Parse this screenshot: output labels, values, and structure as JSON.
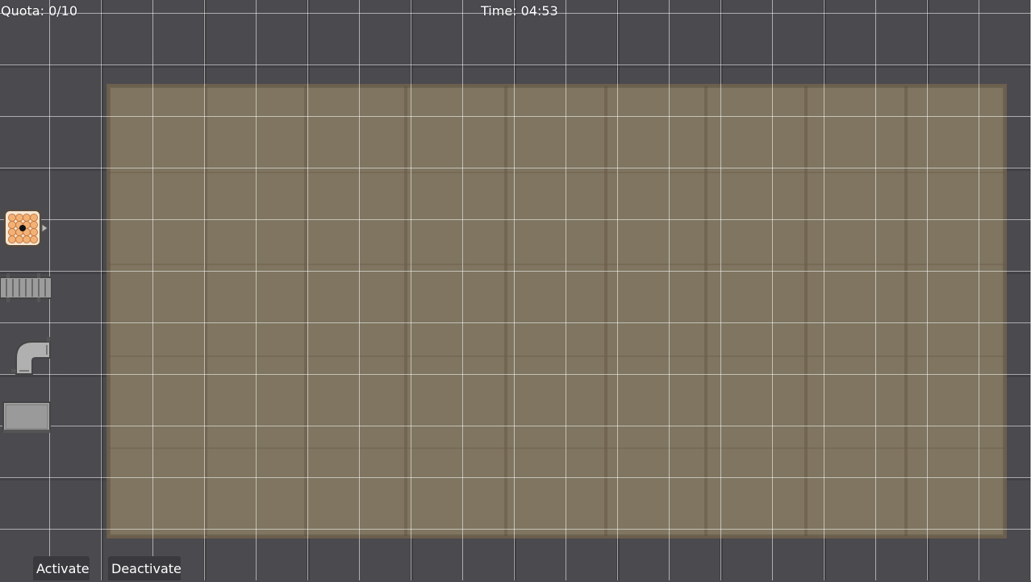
{
  "hud": {
    "quota": "Quota: 0/10",
    "time": "Time: 04:53"
  },
  "palette": {
    "items": [
      {
        "icon": "crate-icon"
      },
      {
        "icon": "conveyor-belt-icon"
      },
      {
        "icon": "pipe-elbow-icon"
      },
      {
        "icon": "metal-box-icon"
      }
    ]
  },
  "controls": {
    "activate_label": "Activate",
    "deactivate_label": "Deactivate"
  },
  "colors": {
    "background": "#4a4a4f",
    "play_area": "#7f7560",
    "play_area_border": "#6b5e4c",
    "grid_lines": "#ffffff"
  }
}
